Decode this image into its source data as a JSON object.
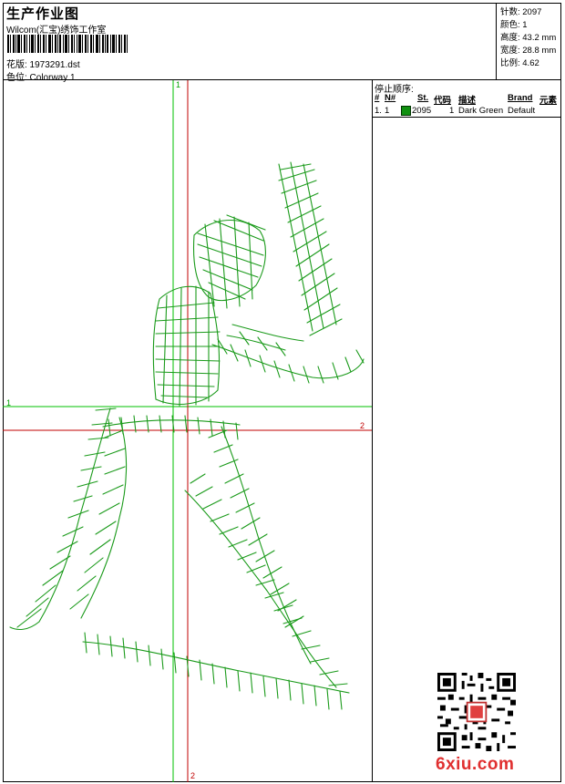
{
  "header": {
    "title": "生产作业图",
    "studio": "Wilcom(汇宝)绣饰工作室",
    "pattern": "花版: 1973291.dst",
    "colorway": "色位: Colorway 1"
  },
  "stats": {
    "stitches": "针数: 2097",
    "colors": "颜色: 1",
    "height": "高度: 43.2 mm",
    "width": "宽度: 28.8 mm",
    "scale": "比例: 4.62"
  },
  "stop_sequence": {
    "title": "停止顺序:",
    "columns": [
      "#",
      "N#",
      "St.",
      "代码",
      "描述",
      "Brand",
      "元素"
    ],
    "rows": [
      {
        "index": "1.",
        "needle": "1",
        "stitches": "2095",
        "code": "1",
        "description": "Dark Green",
        "brand": "Default",
        "swatch_color": "#109010"
      }
    ]
  },
  "guides": {
    "green_vertical": "1",
    "green_horizontal": "1",
    "red_horizontal": "2",
    "red_vertical": "2"
  },
  "colors": {
    "stitch": "#1a9a1a",
    "guide_green": "#00c000",
    "guide_red": "#c00000"
  },
  "watermark": {
    "logo_text": "6xiu.com"
  }
}
